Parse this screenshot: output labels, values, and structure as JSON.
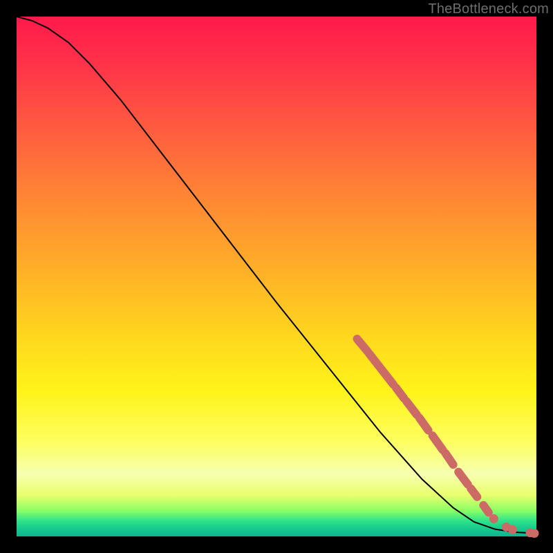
{
  "watermark": "TheBottleneck.com",
  "colors": {
    "background": "#000000",
    "curve": "#000000",
    "marker": "#cc6a66"
  },
  "chart_data": {
    "type": "line",
    "title": "",
    "xlabel": "",
    "ylabel": "",
    "xlim": [
      0,
      100
    ],
    "ylim": [
      0,
      100
    ],
    "grid": false,
    "legend": false,
    "curve": [
      {
        "x": 0,
        "y": 100.0
      },
      {
        "x": 3,
        "y": 99.2
      },
      {
        "x": 6,
        "y": 97.8
      },
      {
        "x": 10,
        "y": 95.0
      },
      {
        "x": 14,
        "y": 91.0
      },
      {
        "x": 20,
        "y": 84.0
      },
      {
        "x": 30,
        "y": 71.0
      },
      {
        "x": 40,
        "y": 58.0
      },
      {
        "x": 50,
        "y": 45.0
      },
      {
        "x": 60,
        "y": 32.5
      },
      {
        "x": 70,
        "y": 20.0
      },
      {
        "x": 78,
        "y": 11.0
      },
      {
        "x": 84,
        "y": 5.5
      },
      {
        "x": 88,
        "y": 2.8
      },
      {
        "x": 92,
        "y": 1.4
      },
      {
        "x": 96,
        "y": 0.8
      },
      {
        "x": 100,
        "y": 0.6
      }
    ],
    "markers_segments": [
      {
        "x1": 65.5,
        "y1": 38.0,
        "x2": 67.5,
        "y2": 35.6
      },
      {
        "x1": 67.8,
        "y1": 35.2,
        "x2": 72.5,
        "y2": 29.2
      },
      {
        "x1": 73.0,
        "y1": 28.6,
        "x2": 74.5,
        "y2": 26.6
      },
      {
        "x1": 75.0,
        "y1": 26.0,
        "x2": 77.0,
        "y2": 23.4
      },
      {
        "x1": 77.5,
        "y1": 22.8,
        "x2": 79.2,
        "y2": 20.4
      },
      {
        "x1": 80.0,
        "y1": 19.4,
        "x2": 82.0,
        "y2": 16.6
      },
      {
        "x1": 82.5,
        "y1": 16.0,
        "x2": 84.0,
        "y2": 13.8
      },
      {
        "x1": 85.0,
        "y1": 12.4,
        "x2": 86.8,
        "y2": 10.0
      },
      {
        "x1": 87.4,
        "y1": 9.2,
        "x2": 88.6,
        "y2": 7.6
      },
      {
        "x1": 89.8,
        "y1": 6.0,
        "x2": 90.8,
        "y2": 4.6
      }
    ],
    "markers_dots": [
      {
        "x": 91.8,
        "y": 3.4
      },
      {
        "x": 94.2,
        "y": 1.8
      },
      {
        "x": 95.4,
        "y": 1.3
      },
      {
        "x": 98.8,
        "y": 0.7
      },
      {
        "x": 99.6,
        "y": 0.6
      }
    ]
  }
}
